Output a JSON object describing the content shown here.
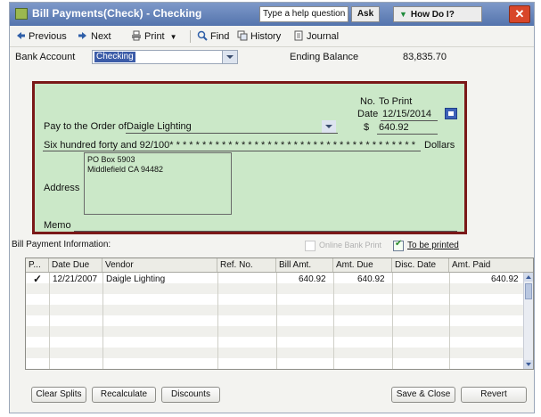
{
  "window": {
    "title": "Bill Payments(Check) - Checking",
    "help_placeholder": "Type a help question",
    "ask_label": "Ask",
    "how_do_i_label": "How Do I?",
    "close_glyph": "✕"
  },
  "toolbar": {
    "previous": "Previous",
    "next": "Next",
    "print": "Print",
    "find": "Find",
    "history": "History",
    "journal": "Journal"
  },
  "bank": {
    "label": "Bank Account",
    "account": "Checking",
    "ending_balance_label": "Ending Balance",
    "ending_balance": "83,835.70"
  },
  "check": {
    "no_label": "No.",
    "no_value": "To Print",
    "date_label": "Date",
    "date_value": "12/15/2014",
    "pay_to_label": "Pay to the Order of",
    "payee": "Daigle Lighting",
    "amount_prefix": "$",
    "amount": "640.92",
    "written_amount": "Six hundred forty and 92/100* * * * * * * * * * * * * * * * * * * * * * * * * * * * * * * * * * * * * * * * * *",
    "dollars_label": "Dollars",
    "address_label": "Address",
    "address_lines": [
      "PO Box 5903",
      "Middlefield CA  94482"
    ],
    "memo_label": "Memo"
  },
  "bill_payment": {
    "label": "Bill Payment Information:",
    "online_bank_print": "Online Bank Print",
    "to_be_printed": "To be printed",
    "to_be_printed_checked": true
  },
  "table": {
    "columns": [
      "P...",
      "Date Due",
      "Vendor",
      "Ref. No.",
      "Bill Amt.",
      "Amt. Due",
      "Disc. Date",
      "Amt. Paid"
    ],
    "rows": [
      {
        "paid": "✓",
        "date_due": "12/21/2007",
        "vendor": "Daigle Lighting",
        "ref_no": "",
        "bill_amt": "640.92",
        "amt_due": "640.92",
        "disc_date": "",
        "amt_paid": "640.92"
      }
    ]
  },
  "buttons": {
    "clear_splits": "Clear Splits",
    "recalculate": "Recalculate",
    "discounts": "Discounts",
    "save_close": "Save & Close",
    "revert": "Revert"
  },
  "colors": {
    "check_bg": "#cbe8c8",
    "check_border": "#7a1818",
    "titlebar": "#5474ad",
    "close": "#d8462a"
  }
}
